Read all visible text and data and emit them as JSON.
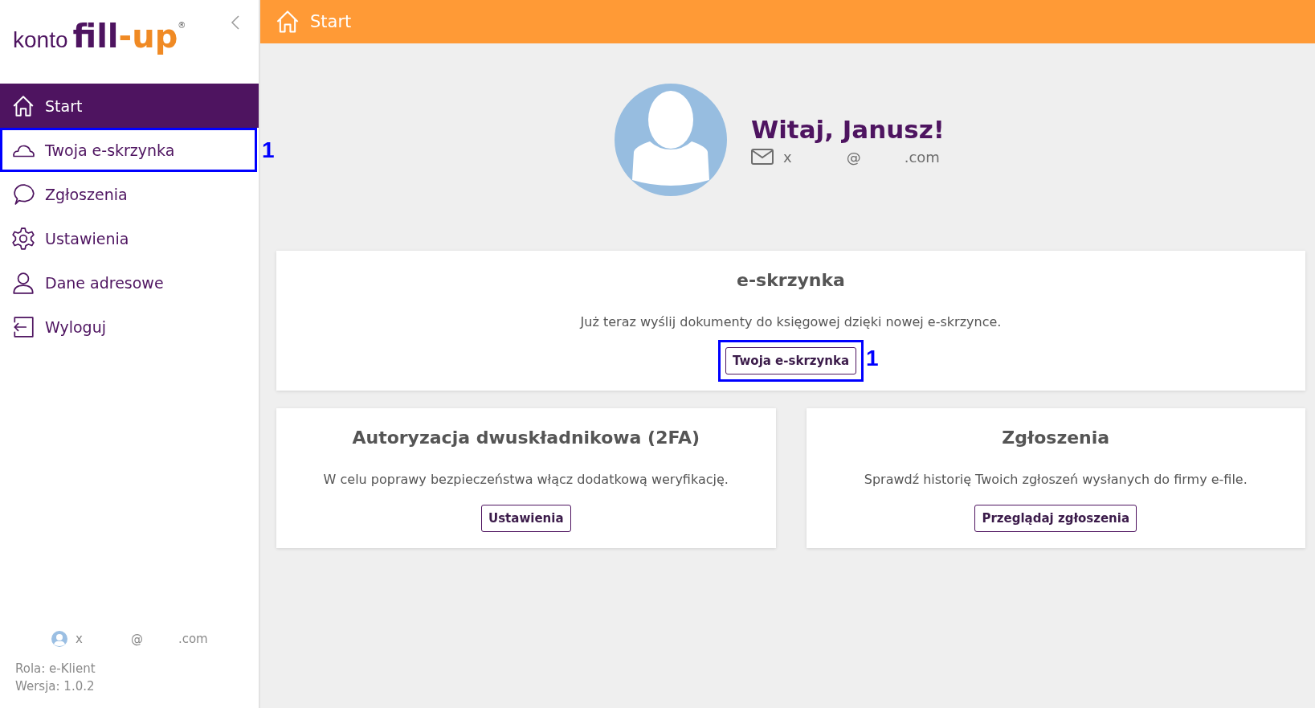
{
  "logo": {
    "prefix": "konto",
    "brand_main": "fill",
    "brand_dash": "-",
    "brand_accent": "up",
    "registered": "®"
  },
  "sidebar": {
    "items": [
      {
        "label": "Start",
        "kind": "home",
        "selected": true
      },
      {
        "label": "Twoja e-skrzynka",
        "kind": "cloud",
        "selected": false,
        "callout": "1"
      },
      {
        "label": "Zgłoszenia",
        "kind": "chat",
        "selected": false
      },
      {
        "label": "Ustawienia",
        "kind": "gear",
        "selected": false
      },
      {
        "label": "Dane adresowe",
        "kind": "person",
        "selected": false
      },
      {
        "label": "Wyloguj",
        "kind": "logout",
        "selected": false
      }
    ],
    "user_email": [
      "x",
      "@",
      ".com"
    ],
    "role": "Rola: e-Klient",
    "version": "Wersja: 1.0.2"
  },
  "header": {
    "title": "Start"
  },
  "profile": {
    "greeting": "Witaj, Janusz!",
    "email": [
      "x",
      "@",
      ".com"
    ]
  },
  "cards": [
    {
      "title": "e-skrzynka",
      "text": "Już teraz wyślij dokumenty do księgowej dzięki nowej e-skrzynce.",
      "button": "Twoja e-skrzynka",
      "callout": "1"
    },
    {
      "title": "Autoryzacja dwuskładnikowa (2FA)",
      "text": "W celu poprawy bezpieczeństwa włącz dodatkową weryfikację.",
      "button": "Ustawienia"
    },
    {
      "title": "Zgłoszenia",
      "text": "Sprawdź historię Twoich zgłoszeń wysłanych do firmy e-file.",
      "button": "Przeglądaj zgłoszenia"
    }
  ]
}
